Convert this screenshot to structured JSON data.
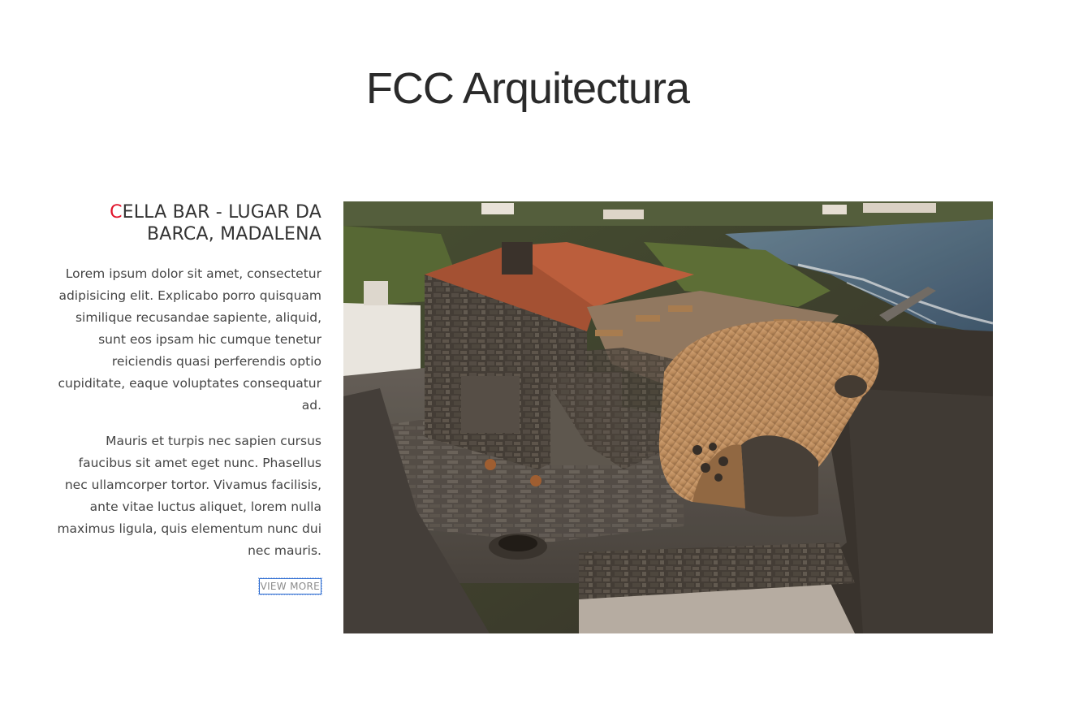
{
  "page": {
    "title": "FCC Arquitectura"
  },
  "project": {
    "heading_initial": "C",
    "heading_rest": "ELLA BAR - LUGAR DA BARCA, MADALENA",
    "paragraphs": [
      "Lorem ipsum dolor sit amet, consectetur adipisicing elit. Explicabo porro quisquam similique recusandae sapiente, aliquid, sunt eos ipsam hic cumque tenetur reiciendis quasi perferendis optio cupiditate, eaque voluptates consequatur ad.",
      "Mauris et turpis nec sapien cursus faucibus sit amet eget nunc. Phasellus nec ullamcorper tortor. Vivamus facilisis, ante vitae luctus aliquet, lorem nulla maximus ligula, quis elementum nunc dui nec mauris."
    ],
    "view_more_label": "VIEW MORE",
    "accent_color": "#e0132a",
    "image_subject": "aerial photo of stone building with wooden tube-shaped bar by the sea"
  }
}
